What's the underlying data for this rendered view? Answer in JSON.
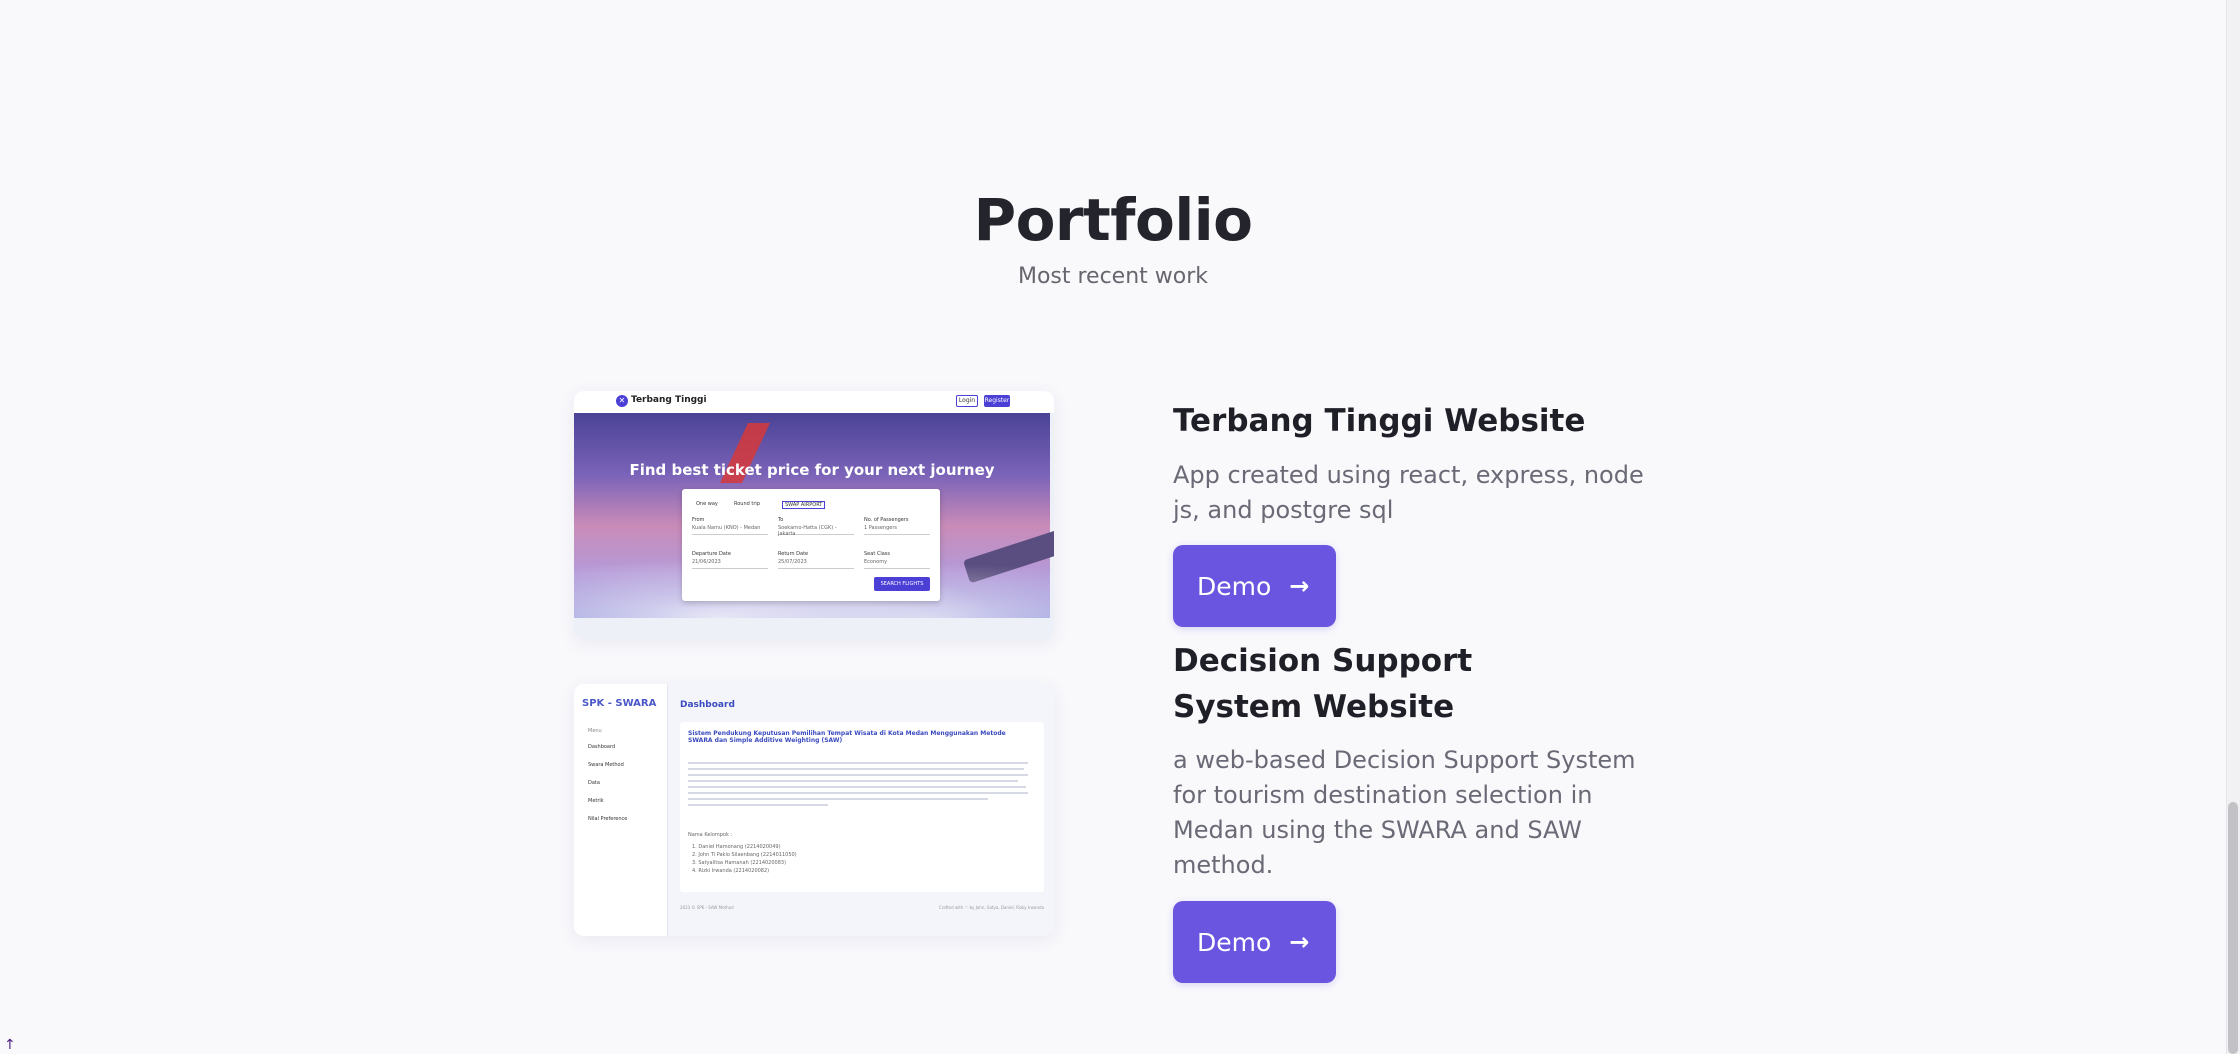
{
  "section": {
    "title": "Portfolio",
    "subtitle": "Most recent work"
  },
  "projects": [
    {
      "title": "Terbang Tinggi Website",
      "description": "App created using react, express, node js, and postgre sql",
      "button": "Demo",
      "preview": {
        "logo": "Terbang Tinggi",
        "login": "Login",
        "register": "Register",
        "heading": "Find best ticket price for your next journey",
        "one_way": "One way",
        "round_trip": "Round trip",
        "swap": "SWAP AIRPORT",
        "from_label": "From",
        "from_value": "Kuala Namu (KNO) - Medan",
        "to_label": "To",
        "to_value": "Soekarno-Hatta (CGK) - Jakarta",
        "pax_label": "No. of Passengers",
        "pax_value": "1 Passengers",
        "dep_label": "Departure Date",
        "dep_value": "21/06/2023",
        "ret_label": "Return Date",
        "ret_value": "25/07/2023",
        "class_label": "Seat Class",
        "class_value": "Economy",
        "search": "SEARCH FLIGHTS"
      }
    },
    {
      "title": "Decision Support System Website",
      "description": "a web-based Decision Support System for tourism destination selection in Medan using the SWARA and SAW method.",
      "button": "Demo",
      "preview": {
        "brand": "SPK - SWARA",
        "menu_title": "Menu",
        "menu": [
          "Dashboard",
          "Swara Method",
          "Data",
          "Metrik",
          "Nilai Preference"
        ],
        "page_title": "Dashboard",
        "card_title": "Sistem Pendukung Keputusan Pemilihan Tempat Wisata di Kota Medan Menggunakan Metode SWARA dan Simple Additive Weighting (SAW)",
        "team_label": "Nama Kelompok :",
        "team": [
          "1. Daniel Hamonang (2214020049)",
          "2. John Ti Pakio Silaenbang (2214011050)",
          "3. Satyalitsa Hamanah (2214020083)",
          "4. Rizki Irwanda (2214020082)"
        ],
        "footer_left": "2023 © SPK - SAW Method",
        "footer_right": "Crafted with ♡ by John, Satya, Daniel, Rizky Irwanda"
      }
    }
  ],
  "icons": {
    "arrow": "→",
    "scroll_up": "↑"
  }
}
